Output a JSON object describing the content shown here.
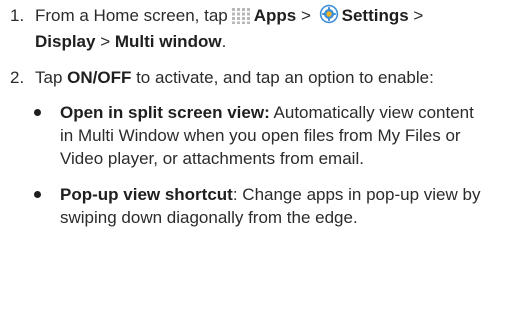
{
  "steps": [
    {
      "number": "1.",
      "text_before": "From a Home screen, tap",
      "apps_icon": "apps-grid-icon",
      "apps_label": "Apps",
      "sep1": " > ",
      "settings_icon": "settings-gear-icon",
      "settings_label": "Settings",
      "sep2": " >",
      "display_label": "Display",
      "sep3": " > ",
      "multi_window_label": "Multi window",
      "end": "."
    },
    {
      "number": "2.",
      "tap": "Tap ",
      "onoff_label": "ON/OFF",
      "text_after": " to activate, and tap an option to enable:"
    }
  ],
  "options": [
    {
      "title": "Open in split screen view:",
      "description": " Automatically view content in Multi Window when you open files from My Files or Video player, or attachments from email."
    },
    {
      "title": "Pop-up view shortcut",
      "description": ": Change apps in pop-up view by swiping down diagonally from the edge."
    }
  ],
  "colors": {
    "text": "#2b2b2b",
    "apps_icon": "#b8b8b8",
    "settings_icon_outer": "#3d8fd6",
    "settings_icon_inner": "#f5b324"
  }
}
